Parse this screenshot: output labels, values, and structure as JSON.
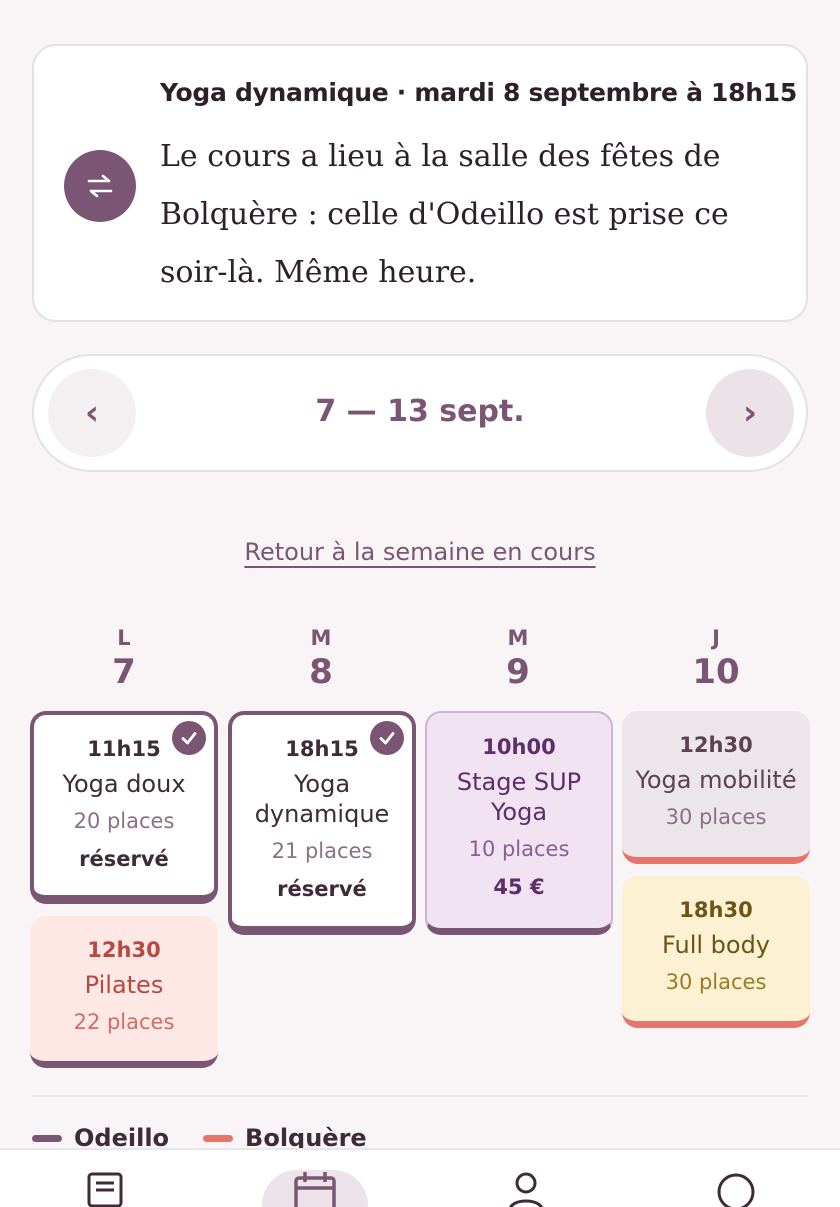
{
  "notice": {
    "title": "Yoga dynamique · mardi 8 septembre à 18h15",
    "body": "Le cours a lieu à la salle des fêtes de Bolquère : celle d'Odeillo est prise ce soir-là. Même heure.",
    "icon": "swap-icon"
  },
  "week_nav": {
    "prev_label": "‹",
    "next_label": "›",
    "range_label": "7 — 13 sept."
  },
  "back_link": "Retour à la semaine en cours",
  "days": [
    {
      "letter": "L",
      "number": "7"
    },
    {
      "letter": "M",
      "number": "8"
    },
    {
      "letter": "M",
      "number": "9"
    },
    {
      "letter": "J",
      "number": "10"
    }
  ],
  "classes": [
    {
      "time": "11h15",
      "name": "Yoga doux",
      "places": "20 places",
      "extra": "réservé",
      "booked": true
    },
    {
      "time": "12h30",
      "name": "Pilates",
      "places": "22 places"
    },
    {
      "time": "18h15",
      "name": "Yoga dynamique",
      "places": "21 places",
      "extra": "réservé",
      "booked": true
    },
    {
      "time": "10h00",
      "name": "Stage SUP Yoga",
      "places": "10 places",
      "extra": "45 €"
    },
    {
      "time": "12h30",
      "name": "Yoga mobilité",
      "places": "30 places"
    },
    {
      "time": "18h30",
      "name": "Full body",
      "places": "30 places"
    }
  ],
  "legend": [
    {
      "label": "Odeillo",
      "color": "#7b5674"
    },
    {
      "label": "Bolquère",
      "color": "#e4766e"
    }
  ],
  "tabs": [
    {
      "icon": "news-icon"
    },
    {
      "icon": "calendar-icon",
      "active": true
    },
    {
      "icon": "user-icon"
    },
    {
      "icon": "chat-icon"
    }
  ],
  "colors": {
    "brand": "#7b5674",
    "bolquere": "#e4766e",
    "background": "#f9f5f6"
  }
}
